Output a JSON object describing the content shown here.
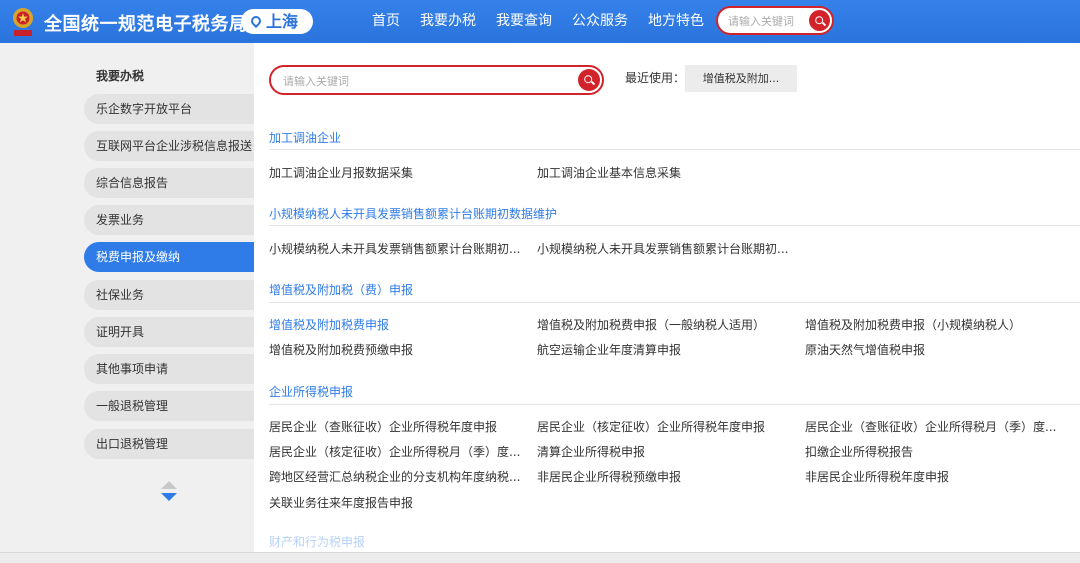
{
  "header": {
    "site_title": "全国统一规范电子税务局",
    "city": "上海",
    "nav": [
      "首页",
      "我要办税",
      "我要查询",
      "公众服务",
      "地方特色"
    ],
    "search_placeholder": "请输入关键词"
  },
  "sidebar": {
    "title": "我要办税",
    "items": [
      {
        "label": "乐企数字开放平台",
        "active": false
      },
      {
        "label": "互联网平台企业涉税信息报送",
        "active": false
      },
      {
        "label": "综合信息报告",
        "active": false
      },
      {
        "label": "发票业务",
        "active": false
      },
      {
        "label": "税费申报及缴纳",
        "active": true
      },
      {
        "label": "社保业务",
        "active": false
      },
      {
        "label": "证明开具",
        "active": false
      },
      {
        "label": "其他事项申请",
        "active": false
      },
      {
        "label": "一般退税管理",
        "active": false
      },
      {
        "label": "出口退税管理",
        "active": false
      }
    ]
  },
  "main": {
    "search_placeholder": "请输入关键词",
    "recent_label": "最近使用：",
    "recent_chip": "增值税及附加...",
    "sections": [
      {
        "title": "加工调油企业",
        "links": [
          "加工调油企业月报数据采集",
          "加工调油企业基本信息采集"
        ]
      },
      {
        "title": "小规模纳税人未开具发票销售额累计台账期初数据维护",
        "links": [
          "小规模纳税人未开具发票销售额累计台账期初...",
          "小规模纳税人未开具发票销售额累计台账期初..."
        ]
      },
      {
        "title": "增值税及附加税（费）申报",
        "links": [
          "增值税及附加税费申报",
          "增值税及附加税费申报（一般纳税人适用）",
          "增值税及附加税费申报（小规模纳税人）",
          "增值税及附加税费预缴申报",
          "航空运输企业年度清算申报",
          "原油天然气增值税申报"
        ]
      },
      {
        "title": "企业所得税申报",
        "links": [
          "居民企业（查账征收）企业所得税年度申报",
          "居民企业（核定征收）企业所得税年度申报",
          "居民企业（查账征收）企业所得税月（季）度...",
          "居民企业（核定征收）企业所得税月（季）度...",
          "清算企业所得税申报",
          "扣缴企业所得税报告",
          "跨地区经营汇总纳税企业的分支机构年度纳税...",
          "非居民企业所得税预缴申报",
          "非居民企业所得税年度申报",
          "关联业务往来年度报告申报"
        ]
      }
    ],
    "next_section_partial": "财产和行为税申报"
  },
  "colors": {
    "brand_blue": "#2f7ce8",
    "search_red": "#d2232a",
    "sidebar_bg": "#f0f0f0",
    "sidebar_item_bg": "#e3e3e3"
  },
  "icons": [
    "national-emblem-icon",
    "location-pin-icon",
    "search-icon",
    "scroll-up-icon",
    "scroll-down-icon"
  ]
}
